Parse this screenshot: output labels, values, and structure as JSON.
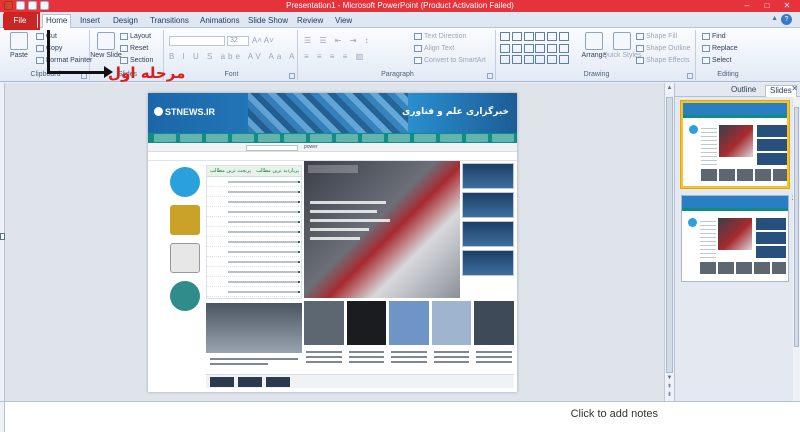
{
  "window": {
    "title": "Presentation1 - Microsoft PowerPoint (Product Activation Failed)",
    "controls": [
      "–",
      "□",
      "✕"
    ]
  },
  "tabs": [
    {
      "label": "File",
      "state": "file"
    },
    {
      "label": "Home",
      "state": "active"
    },
    {
      "label": "Insert"
    },
    {
      "label": "Design"
    },
    {
      "label": "Transitions"
    },
    {
      "label": "Animations"
    },
    {
      "label": "Slide Show"
    },
    {
      "label": "Review"
    },
    {
      "label": "View"
    }
  ],
  "ribbon": {
    "clipboard": {
      "label": "Clipboard",
      "paste": "Paste",
      "cut": "Cut",
      "copy": "Copy",
      "format_painter": "Format Painter"
    },
    "slides": {
      "label": "Slides",
      "new_slide": "New Slide",
      "layout": "Layout",
      "reset": "Reset",
      "section": "Section"
    },
    "font": {
      "label": "Font",
      "size": "32"
    },
    "paragraph": {
      "label": "Paragraph",
      "text_direction": "Text Direction",
      "align_text": "Align Text",
      "convert_smartart": "Convert to SmartArt"
    },
    "drawing": {
      "label": "Drawing",
      "arrange": "Arrange",
      "quick_styles": "Quick Styles",
      "shape_fill": "Shape Fill",
      "shape_outline": "Shape Outline",
      "shape_effects": "Shape Effects"
    },
    "editing": {
      "label": "Editing",
      "find": "Find",
      "replace": "Replace",
      "select": "Select"
    }
  },
  "annotation": {
    "label": "مرحله اول",
    "color": "#e01919"
  },
  "slide_content": {
    "logo": "STNEWS.IR",
    "site_title": "خبرگزاری علم و فناوری",
    "search_button": "power",
    "list_tabs": [
      "پربحث ترین مطالب",
      "پربازدید ترین مطالب"
    ]
  },
  "side_pane": {
    "tabs": [
      "Outline",
      "Slides"
    ],
    "active_tab": "Slides",
    "close": "✕",
    "slides": [
      {
        "number": "1",
        "selected": true
      },
      {
        "number": "2",
        "selected": false
      }
    ]
  },
  "notes": {
    "placeholder": "Click to add notes"
  },
  "colors": {
    "title_bar": "#e6333b",
    "file_tab": "#c62828",
    "selected_slide_border": "#f1c232"
  }
}
